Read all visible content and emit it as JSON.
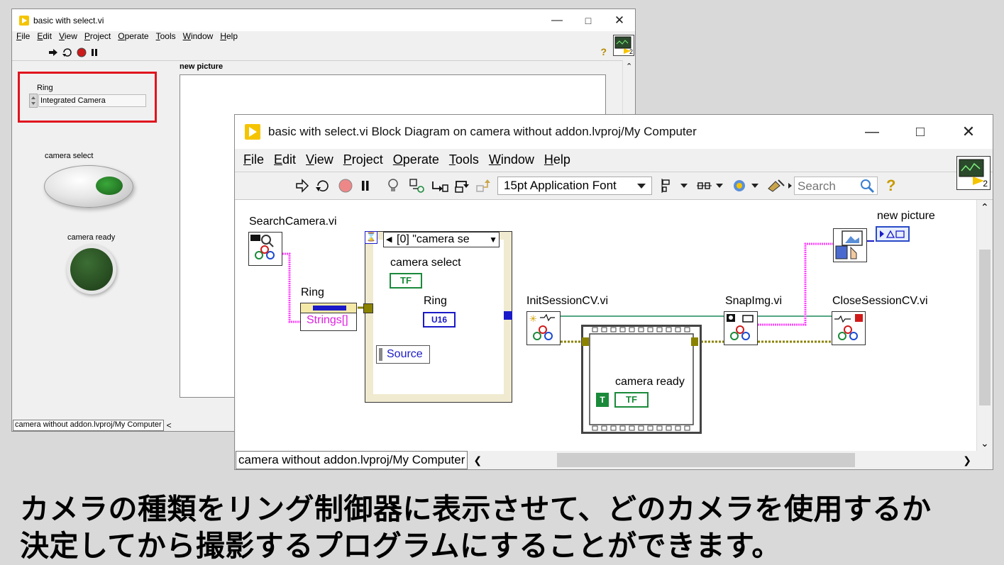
{
  "front_panel": {
    "title": "basic with select.vi",
    "menu": [
      "File",
      "Edit",
      "View",
      "Project",
      "Operate",
      "Tools",
      "Window",
      "Help"
    ],
    "ring": {
      "label": "Ring",
      "value": "Integrated Camera"
    },
    "camera_select": {
      "label": "camera select"
    },
    "camera_ready": {
      "label": "camera ready"
    },
    "picture": {
      "label": "new picture"
    },
    "status": "camera without addon.lvproj/My Computer",
    "scroll_left": "<",
    "conn_pane_number": "2"
  },
  "block_diagram": {
    "title": "basic with select.vi Block Diagram on camera without addon.lvproj/My Computer",
    "menu": [
      "File",
      "Edit",
      "View",
      "Project",
      "Operate",
      "Tools",
      "Window",
      "Help"
    ],
    "font_select": "15pt Application Font",
    "search_placeholder": "Search",
    "conn_pane_number": "2",
    "nodes": {
      "search_camera": "SearchCamera.vi",
      "ring": "Ring",
      "strings": "Strings[]",
      "case_selector": "[0] \"camera se",
      "camera_select": "camera select",
      "tf": "TF",
      "ring_inner": "Ring",
      "u16": "U16",
      "source": "Source",
      "init_session": "InitSessionCV.vi",
      "snap_img": "SnapImg.vi",
      "close_session": "CloseSessionCV.vi",
      "new_picture": "new picture",
      "camera_ready": "camera ready",
      "true_const": "T",
      "tf2": "TF"
    },
    "status": "camera without addon.lvproj/My Computer"
  },
  "caption": {
    "line1": "カメラの種類をリング制御器に表示させて、どのカメラを使用するか",
    "line2": "決定してから撮影するプログラムにすることができます。"
  },
  "colors": {
    "highlight_box": "#e0141e",
    "lv_yellow": "#f5c400",
    "wire_pink": "#ff44ff",
    "wire_blue": "#1a1ac8",
    "wire_green": "#1a8a3a",
    "wire_olive": "#8a8200"
  }
}
